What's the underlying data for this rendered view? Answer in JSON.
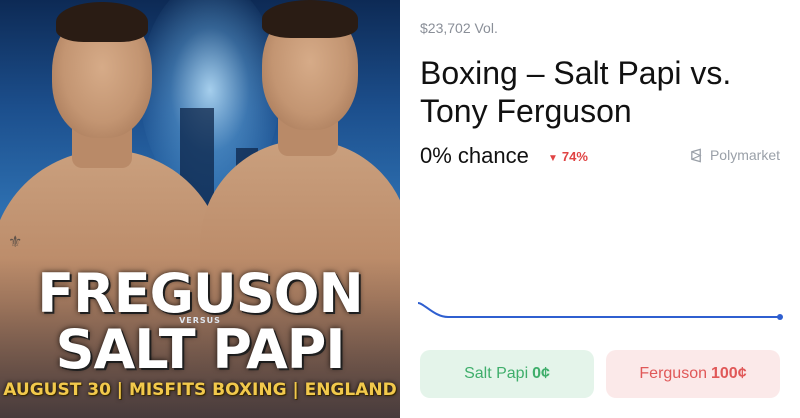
{
  "poster": {
    "name1": "FREGUSON",
    "versus": "VERSUS",
    "name2": "SALT PAPI",
    "event_line": "AUGUST 30 | MISFITS BOXING | ENGLAND"
  },
  "market": {
    "volume": "$23,702 Vol.",
    "title": "Boxing – Salt Papi vs. Tony Ferguson",
    "chance": "0% chance",
    "change": "74%",
    "change_direction": "down",
    "brand": "Polymarket"
  },
  "chart_data": {
    "type": "line",
    "series": [
      {
        "values": [
          3,
          0,
          0,
          0,
          0,
          0,
          0,
          0,
          0,
          0,
          0,
          0,
          0
        ]
      }
    ],
    "ylim": [
      0,
      100
    ],
    "line_color": "#2f5fd0"
  },
  "buttons": {
    "yes": {
      "label": "Salt Papi",
      "price": "0¢"
    },
    "no": {
      "label": "Ferguson",
      "price": "100¢"
    }
  },
  "colors": {
    "yes_bg": "#e4f4ea",
    "yes_text": "#3fae6b",
    "no_bg": "#fbe9e9",
    "no_text": "#e05858",
    "change_down": "#e04343"
  }
}
